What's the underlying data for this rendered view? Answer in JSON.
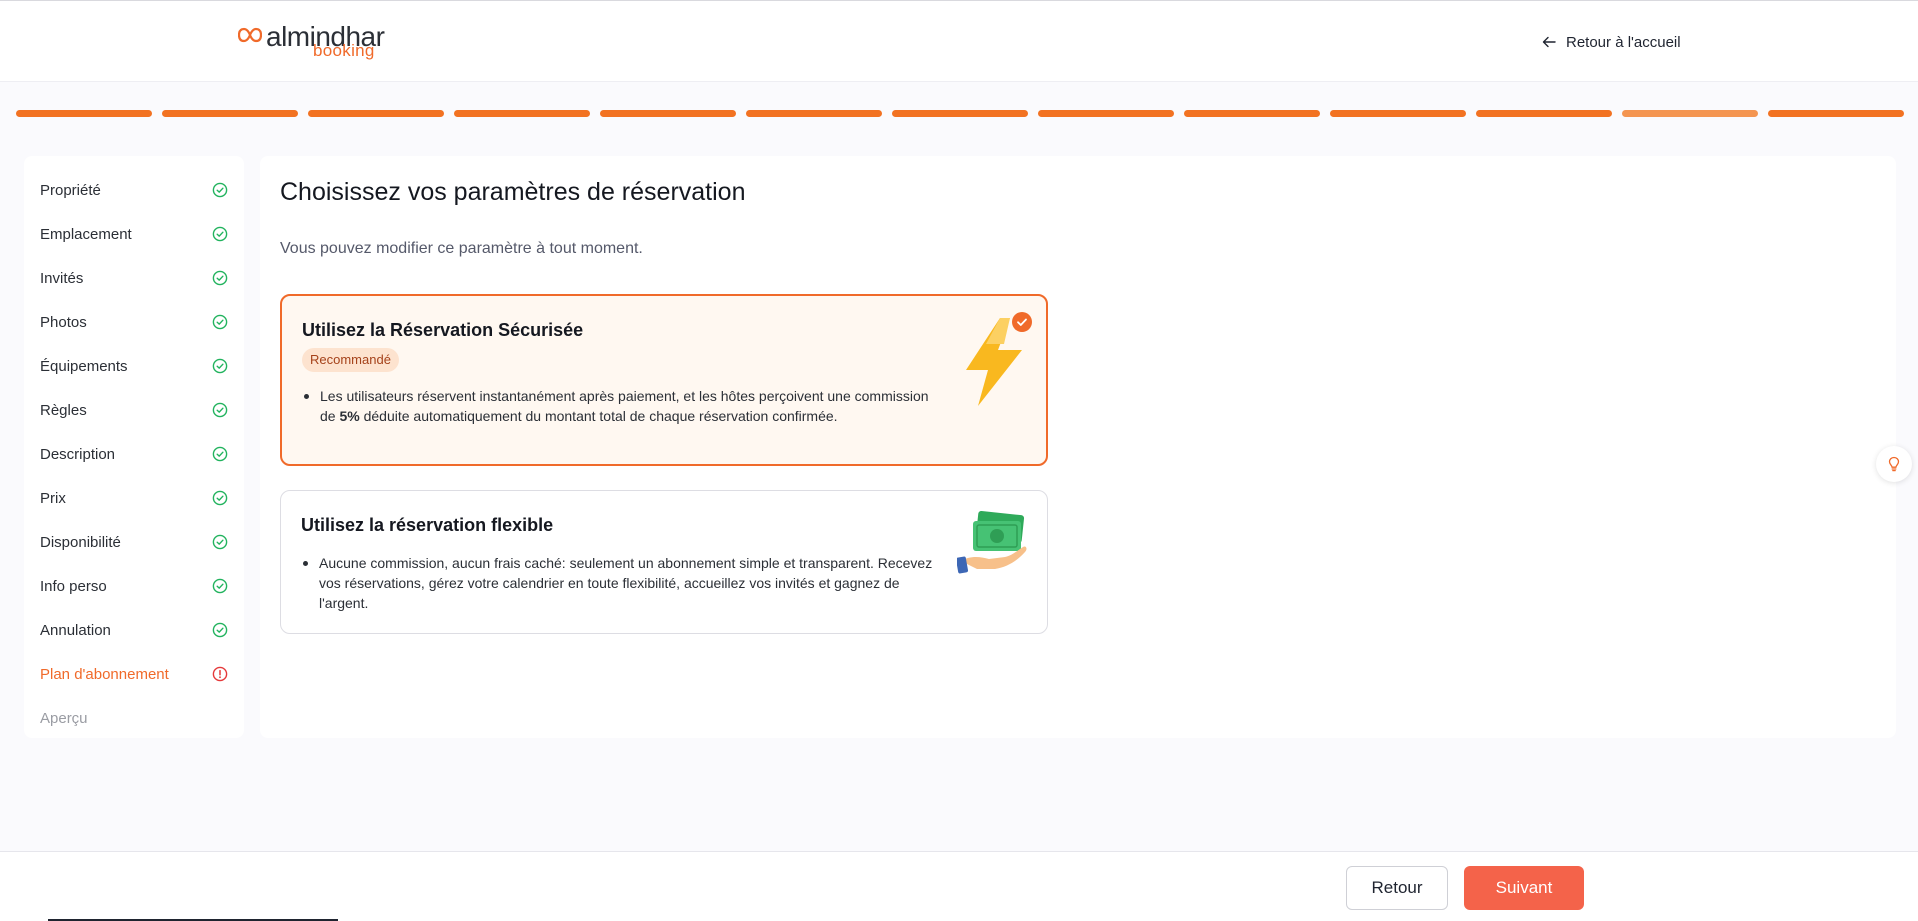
{
  "header": {
    "logo_word": "almindhar",
    "logo_sub": "booking",
    "back_home_label": "Retour à l'accueil"
  },
  "progress": {
    "total_steps": 13,
    "completed_steps": 11,
    "current_step": 12
  },
  "sidebar": {
    "items": [
      {
        "label": "Propriété",
        "status": "done"
      },
      {
        "label": "Emplacement",
        "status": "done"
      },
      {
        "label": "Invités",
        "status": "done"
      },
      {
        "label": "Photos",
        "status": "done"
      },
      {
        "label": "Équipements",
        "status": "done"
      },
      {
        "label": "Règles",
        "status": "done"
      },
      {
        "label": "Description",
        "status": "done"
      },
      {
        "label": "Prix",
        "status": "done"
      },
      {
        "label": "Disponibilité",
        "status": "done"
      },
      {
        "label": "Info perso",
        "status": "done"
      },
      {
        "label": "Annulation",
        "status": "done"
      },
      {
        "label": "Plan d'abonnement",
        "status": "warning"
      },
      {
        "label": "Aperçu",
        "status": "pending"
      }
    ]
  },
  "main": {
    "title": "Choisissez vos paramètres de réservation",
    "subtitle": "Vous pouvez modifier ce paramètre à tout moment.",
    "options": [
      {
        "title": "Utilisez la Réservation Sécurisée",
        "badge": "Recommandé",
        "desc_before": "Les utilisateurs réservent instantanément après paiement, et les hôtes perçoivent une commission de ",
        "desc_bold": "5%",
        "desc_after": " déduite automatiquement du montant total de chaque réservation confirmée.",
        "selected": true,
        "icon": "lightning-icon"
      },
      {
        "title": "Utilisez la réservation flexible",
        "desc": "Aucune commission, aucun frais caché: seulement un abonnement simple et transparent. Recevez vos réservations, gérez votre calendrier en toute flexibilité, accueillez vos invités et gagnez de l'argent.",
        "selected": false,
        "icon": "money-hand-icon"
      }
    ]
  },
  "footer": {
    "back_label": "Retour",
    "next_label": "Suivant"
  },
  "colors": {
    "accent": "#f06a2a",
    "success": "#22b35e",
    "warning": "#e5393a",
    "next_button": "#f4634a"
  }
}
